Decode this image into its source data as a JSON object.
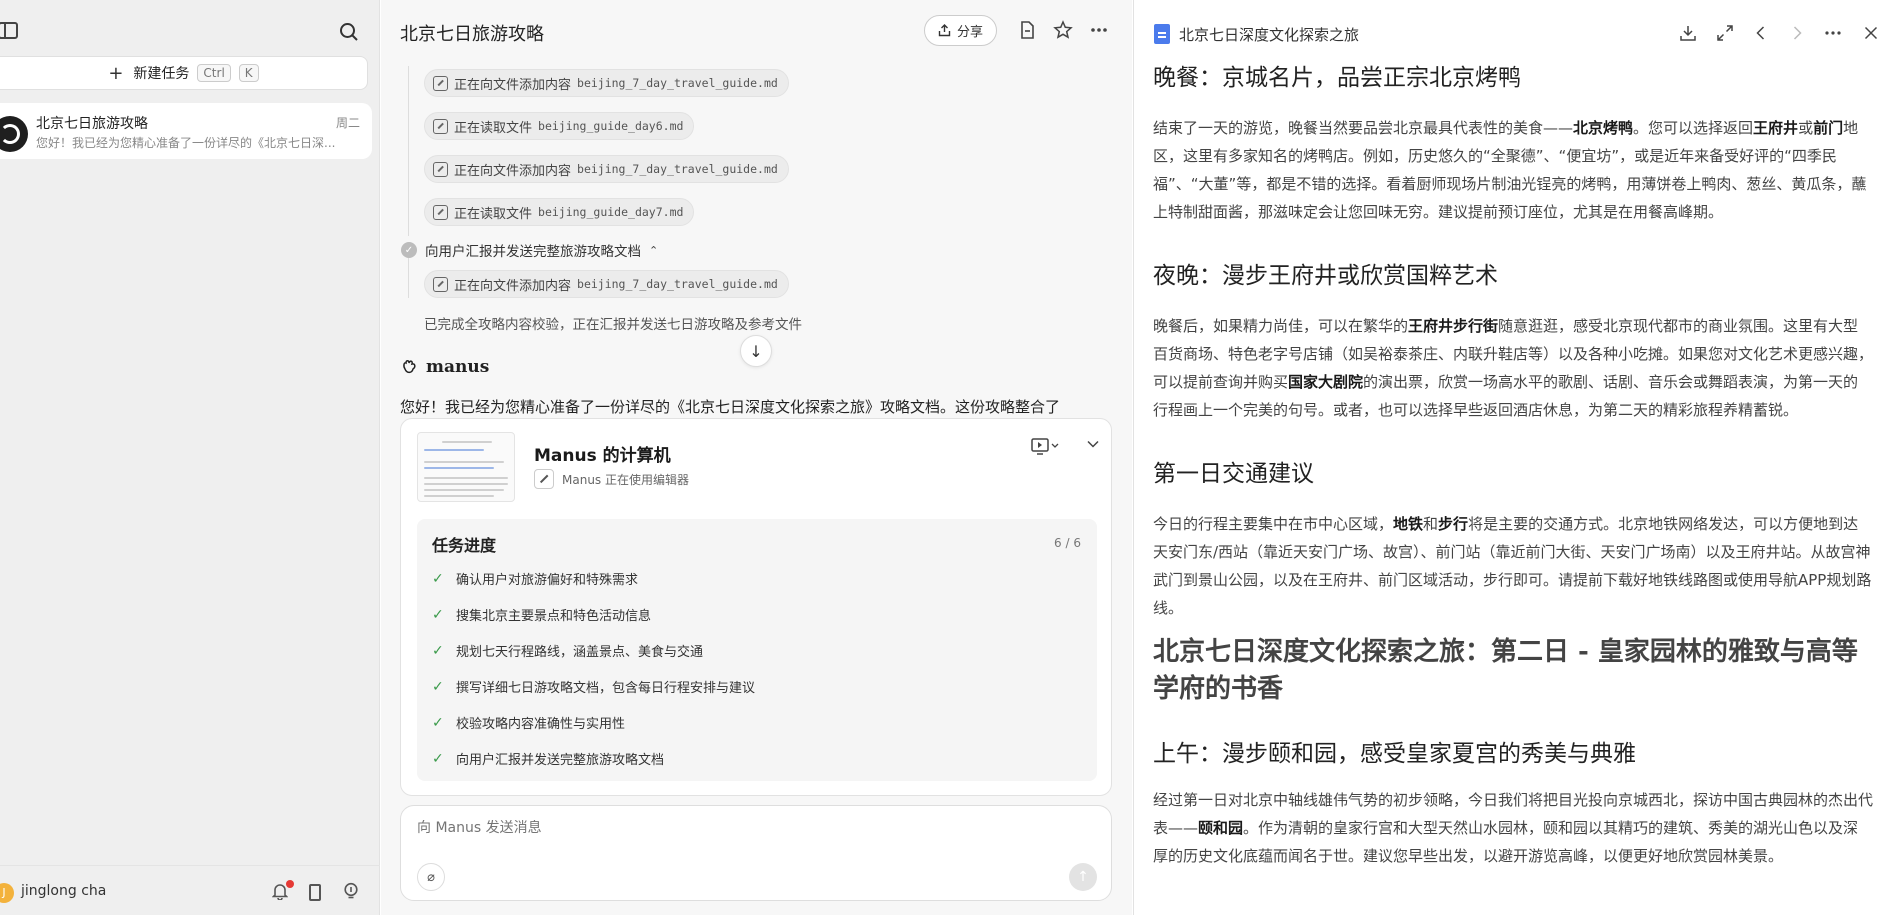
{
  "sidebar": {
    "new_task_label": "新建任务",
    "shortcut_ctrl": "Ctrl",
    "shortcut_key": "K",
    "conversation": {
      "title": "北京七日旅游攻略",
      "date": "周二",
      "preview": "您好！我已经为您精心准备了一份详尽的《北京七日深..."
    },
    "user": {
      "initial": "J",
      "name": "jinglong cha"
    }
  },
  "chat": {
    "title": "北京七日旅游攻略",
    "share_label": "分享",
    "steps": [
      {
        "label": "正在向文件添加内容",
        "file": "beijing_7_day_travel_guide.md"
      },
      {
        "label": "正在读取文件",
        "file": "beijing_guide_day6.md"
      },
      {
        "label": "正在向文件添加内容",
        "file": "beijing_7_day_travel_guide.md"
      },
      {
        "label": "正在读取文件",
        "file": "beijing_guide_day7.md"
      }
    ],
    "phase_title": "向用户汇报并发送完整旅游攻略文档",
    "phase_steps": [
      {
        "label": "正在向文件添加内容",
        "file": "beijing_7_day_travel_guide.md"
      }
    ],
    "phase_note": "已完成全攻略内容校验，正在汇报并发送七日游攻略及参考文件",
    "assistant_name": "manus",
    "assistant_message": "您好！我已经为您精心准备了一份详尽的《北京七日深度文化探索之旅》攻略文档。这份攻略整合了",
    "computer": {
      "title": "Manus 的计算机",
      "status": "Manus 正在使用编辑器"
    },
    "progress": {
      "title": "任务进度",
      "count": "6 / 6",
      "items": [
        "确认用户对旅游偏好和特殊需求",
        "搜集北京主要景点和特色活动信息",
        "规划七天行程路线，涵盖景点、美食与交通",
        "撰写详细七日游攻略文档，包含每日行程安排与建议",
        "校验攻略内容准确性与实用性",
        "向用户汇报并发送完整旅游攻略文档"
      ]
    },
    "input_placeholder": "向 Manus 发送消息"
  },
  "document": {
    "title": "北京七日深度文化探索之旅",
    "sections": [
      {
        "heading": "晚餐：京城名片，品尝正宗北京烤鸭",
        "html": "结束了一天的游览，晚餐当然要品尝北京最具代表性的美食——<b>北京烤鸭</b>。您可以选择返回<b>王府井</b>或<b>前门</b>地区，这里有多家知名的烤鸭店。例如，历史悠久的“全聚德”、“便宜坊”，或是近年来备受好评的“四季民福”、“大董”等，都是不错的选择。看着厨师现场片制油光锃亮的烤鸭，用薄饼卷上鸭肉、葱丝、黄瓜条，蘸上特制甜面酱，那滋味定会让您回味无穷。建议提前预订座位，尤其是在用餐高峰期。"
      },
      {
        "heading": "夜晚：漫步王府井或欣赏国粹艺术",
        "html": "晚餐后，如果精力尚佳，可以在繁华的<b>王府井步行街</b>随意逛逛，感受北京现代都市的商业氛围。这里有大型百货商场、特色老字号店铺（如吴裕泰茶庄、内联升鞋店等）以及各种小吃摊。如果您对文化艺术更感兴趣，可以提前查询并购买<b>国家大剧院</b>的演出票，欣赏一场高水平的歌剧、话剧、音乐会或舞蹈表演，为第一天的行程画上一个完美的句号。或者，也可以选择早些返回酒店休息，为第二天的精彩旅程养精蓄锐。"
      },
      {
        "heading": "第一日交通建议",
        "html": "今日的行程主要集中在市中心区域，<b>地铁</b>和<b>步行</b>将是主要的交通方式。北京地铁网络发达，可以方便地到达天安门东/西站（靠近天安门广场、故宫）、前门站（靠近前门大街、天安门广场南）以及王府井站。从故宫神武门到景山公园，以及在王府井、前门区域活动，步行即可。请提前下载好地铁线路图或使用导航APP规划路线。"
      }
    ],
    "day2_title": "北京七日深度文化探索之旅：第二日 - 皇家园林的雅致与高等学府的书香",
    "day2_section": {
      "heading": "上午：漫步颐和园，感受皇家夏宫的秀美与典雅",
      "html": "经过第一日对北京中轴线雄伟气势的初步领略，今日我们将把目光投向京城西北，探访中国古典园林的杰出代表——<b>颐和园</b>。作为清朝的皇家行宫和大型天然山水园林，颐和园以其精巧的建筑、秀美的湖光山色以及深厚的历史文化底蕴而闻名于世。建议您早些出发，以避开游览高峰，以便更好地欣赏园林美景。"
    }
  },
  "colors": {
    "accent": "#4b7bec",
    "check": "#3a9a4a",
    "notification": "#e53935"
  }
}
